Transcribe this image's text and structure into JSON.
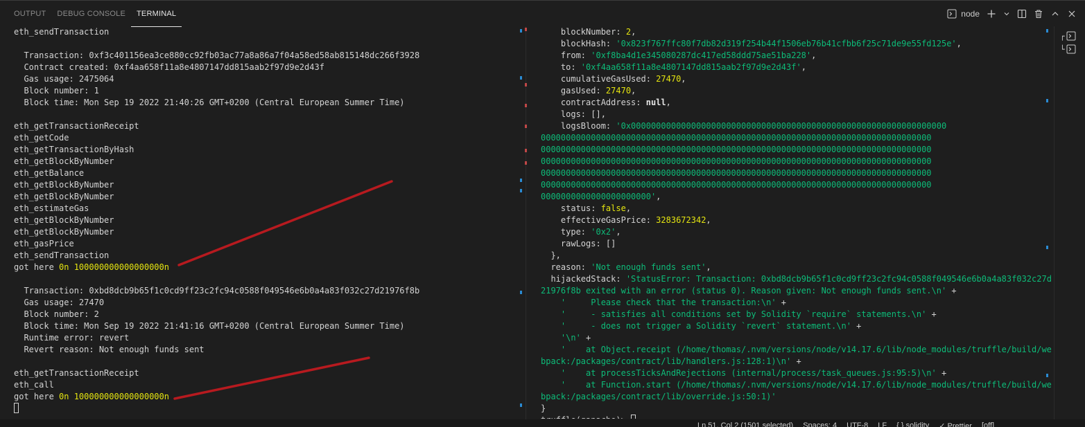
{
  "panel": {
    "tabs": [
      {
        "label": "OUTPUT",
        "active": false
      },
      {
        "label": "DEBUG CONSOLE",
        "active": false
      },
      {
        "label": "TERMINAL",
        "active": true
      }
    ],
    "terminal_label": "node"
  },
  "left_pane": {
    "lines": [
      {
        "t": "eth_sendTransaction"
      },
      {
        "t": ""
      },
      {
        "t": "  Transaction: 0xf3c401156ea3ce880cc92fb03ac77a8a86a7f04a58ed58ab815148dc266f3928"
      },
      {
        "t": "  Contract created: 0xf4aa658f11a8e4807147dd815aab2f97d9e2d43f"
      },
      {
        "t": "  Gas usage: 2475064"
      },
      {
        "t": "  Block number: 1"
      },
      {
        "t": "  Block time: Mon Sep 19 2022 21:40:26 GMT+0200 (Central European Summer Time)"
      },
      {
        "t": ""
      },
      {
        "t": "eth_getTransactionReceipt"
      },
      {
        "t": "eth_getCode"
      },
      {
        "t": "eth_getTransactionByHash"
      },
      {
        "t": "eth_getBlockByNumber"
      },
      {
        "t": "eth_getBalance"
      },
      {
        "t": "eth_getBlockByNumber"
      },
      {
        "t": "eth_getBlockByNumber"
      },
      {
        "t": "eth_estimateGas"
      },
      {
        "t": "eth_getBlockByNumber"
      },
      {
        "t": "eth_getBlockByNumber"
      },
      {
        "t": "eth_gasPrice"
      },
      {
        "t": "eth_sendTransaction"
      },
      {
        "t": "got here ",
        "y": "0n 100000000000000000n"
      },
      {
        "t": ""
      },
      {
        "t": "  Transaction: 0xbd8dcb9b65f1c0cd9ff23c2fc94c0588f049546e6b0a4a83f032c27d21976f8b"
      },
      {
        "t": "  Gas usage: 27470"
      },
      {
        "t": "  Block number: 2"
      },
      {
        "t": "  Block time: Mon Sep 19 2022 21:41:16 GMT+0200 (Central European Summer Time)"
      },
      {
        "t": "  Runtime error: revert"
      },
      {
        "t": "  Revert reason: Not enough funds sent"
      },
      {
        "t": ""
      },
      {
        "t": "eth_getTransactionReceipt"
      },
      {
        "t": "eth_call"
      },
      {
        "t": "got here ",
        "y": "0n 100000000000000000n"
      }
    ]
  },
  "right_pane": {
    "lines": [
      [
        {
          "c": "",
          "v": "    blockNumber: "
        },
        {
          "c": "y",
          "v": "2"
        },
        {
          "c": "",
          "v": ","
        }
      ],
      [
        {
          "c": "",
          "v": "    blockHash: "
        },
        {
          "c": "g",
          "v": "'0x823f767ffc80f7db82d319f254b44f1506eb76b41cfbb6f25c71de9e55fd125e'"
        },
        {
          "c": "",
          "v": ","
        }
      ],
      [
        {
          "c": "",
          "v": "    from: "
        },
        {
          "c": "g",
          "v": "'0xf8ba4d1e345080287dc417ed58ddd75ae51ba228'"
        },
        {
          "c": "",
          "v": ","
        }
      ],
      [
        {
          "c": "",
          "v": "    to: "
        },
        {
          "c": "g",
          "v": "'0xf4aa658f11a8e4807147dd815aab2f97d9e2d43f'"
        },
        {
          "c": "",
          "v": ","
        }
      ],
      [
        {
          "c": "",
          "v": "    cumulativeGasUsed: "
        },
        {
          "c": "y",
          "v": "27470"
        },
        {
          "c": "",
          "v": ","
        }
      ],
      [
        {
          "c": "",
          "v": "    gasUsed: "
        },
        {
          "c": "y",
          "v": "27470"
        },
        {
          "c": "",
          "v": ","
        }
      ],
      [
        {
          "c": "",
          "v": "    contractAddress: "
        },
        {
          "c": "w",
          "v": "null"
        },
        {
          "c": "",
          "v": ","
        }
      ],
      [
        {
          "c": "",
          "v": "    logs: [],"
        }
      ],
      [
        {
          "c": "",
          "v": "    logsBloom: "
        },
        {
          "c": "g",
          "v": "'0x000000000000000000000000000000000000000000000000000000000000000"
        }
      ],
      [
        {
          "c": "g",
          "v": "000000000000000000000000000000000000000000000000000000000000000000000000000000"
        }
      ],
      [
        {
          "c": "g",
          "v": "000000000000000000000000000000000000000000000000000000000000000000000000000000"
        }
      ],
      [
        {
          "c": "g",
          "v": "000000000000000000000000000000000000000000000000000000000000000000000000000000"
        }
      ],
      [
        {
          "c": "g",
          "v": "000000000000000000000000000000000000000000000000000000000000000000000000000000"
        }
      ],
      [
        {
          "c": "g",
          "v": "000000000000000000000000000000000000000000000000000000000000000000000000000000"
        }
      ],
      [
        {
          "c": "g",
          "v": "0000000000000000000000'"
        },
        {
          "c": "",
          "v": ","
        }
      ],
      [
        {
          "c": "",
          "v": "    status: "
        },
        {
          "c": "y",
          "v": "false"
        },
        {
          "c": "",
          "v": ","
        }
      ],
      [
        {
          "c": "",
          "v": "    effectiveGasPrice: "
        },
        {
          "c": "y",
          "v": "3283672342"
        },
        {
          "c": "",
          "v": ","
        }
      ],
      [
        {
          "c": "",
          "v": "    type: "
        },
        {
          "c": "g",
          "v": "'0x2'"
        },
        {
          "c": "",
          "v": ","
        }
      ],
      [
        {
          "c": "",
          "v": "    rawLogs: []"
        }
      ],
      [
        {
          "c": "",
          "v": "  },"
        }
      ],
      [
        {
          "c": "",
          "v": "  reason: "
        },
        {
          "c": "g",
          "v": "'Not enough funds sent'"
        },
        {
          "c": "",
          "v": ","
        }
      ],
      [
        {
          "c": "",
          "v": "  hijackedStack: "
        },
        {
          "c": "g",
          "v": "'StatusError: Transaction: 0xbd8dcb9b65f1c0cd9ff23c2fc94c0588f049546e6b0a4a83f032c27d"
        }
      ],
      [
        {
          "c": "g",
          "v": "21976f8b exited with an error (status 0). Reason given: Not enough funds sent.\\n'"
        },
        {
          "c": "",
          "v": " +"
        }
      ],
      [
        {
          "c": "g",
          "v": "    '     Please check that the transaction:\\n'"
        },
        {
          "c": "",
          "v": " +"
        }
      ],
      [
        {
          "c": "g",
          "v": "    '     - satisfies all conditions set by Solidity `require` statements.\\n'"
        },
        {
          "c": "",
          "v": " +"
        }
      ],
      [
        {
          "c": "g",
          "v": "    '     - does not trigger a Solidity `revert` statement.\\n'"
        },
        {
          "c": "",
          "v": " +"
        }
      ],
      [
        {
          "c": "g",
          "v": "    '\\n'"
        },
        {
          "c": "",
          "v": " +"
        }
      ],
      [
        {
          "c": "g",
          "v": "    '    at Object.receipt (/home/thomas/.nvm/versions/node/v14.17.6/lib/node_modules/truffle/build/we"
        }
      ],
      [
        {
          "c": "g",
          "v": "bpack:/packages/contract/lib/handlers.js:128:1)\\n'"
        },
        {
          "c": "",
          "v": " +"
        }
      ],
      [
        {
          "c": "g",
          "v": "    '    at processTicksAndRejections (internal/process/task_queues.js:95:5)\\n'"
        },
        {
          "c": "",
          "v": " +"
        }
      ],
      [
        {
          "c": "g",
          "v": "    '    at Function.start (/home/thomas/.nvm/versions/node/v14.17.6/lib/node_modules/truffle/build/we"
        }
      ],
      [
        {
          "c": "g",
          "v": "bpack:/packages/contract/lib/override.js:50:1)'"
        }
      ],
      [
        {
          "c": "",
          "v": "}"
        }
      ],
      [
        {
          "c": "",
          "v": "truffle(ganache)> "
        }
      ]
    ]
  },
  "status_bar": {
    "items": [
      "Ln 51, Col 2 (1501 selected)",
      "Spaces: 4",
      "UTF-8",
      "LF",
      "{ } solidity",
      "✓ Prettier",
      "[off]"
    ]
  },
  "colors": {
    "yellow": "#e5e510",
    "green": "#0dbc79",
    "annotation": "#c8191f"
  }
}
